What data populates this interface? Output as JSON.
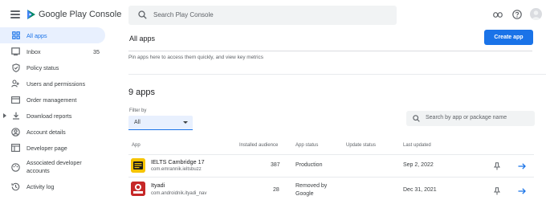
{
  "brand": {
    "name": "Google Play Console"
  },
  "search": {
    "placeholder": "Search Play Console"
  },
  "sidebar": {
    "items": [
      {
        "label": "All apps",
        "icon": "grid-icon",
        "active": true,
        "count": ""
      },
      {
        "label": "Inbox",
        "icon": "inbox-icon",
        "active": false,
        "count": "35"
      },
      {
        "label": "Policy status",
        "icon": "shield-icon",
        "active": false,
        "count": ""
      },
      {
        "label": "Users and permissions",
        "icon": "person-icon",
        "active": false,
        "count": ""
      },
      {
        "label": "Order management",
        "icon": "card-icon",
        "active": false,
        "count": ""
      },
      {
        "label": "Download reports",
        "icon": "download-icon",
        "active": false,
        "count": ""
      },
      {
        "label": "Account details",
        "icon": "account-icon",
        "active": false,
        "count": ""
      },
      {
        "label": "Developer page",
        "icon": "page-icon",
        "active": false,
        "count": ""
      },
      {
        "label": "Associated developer accounts",
        "icon": "palette-icon",
        "active": false,
        "count": ""
      },
      {
        "label": "Activity log",
        "icon": "history-icon",
        "active": false,
        "count": ""
      }
    ]
  },
  "main": {
    "title": "All apps",
    "create_button": "Create app",
    "pin_hint": "Pin apps here to access them quickly, and view key metrics",
    "apps_count": "9 apps",
    "filter": {
      "label": "Filter by",
      "value": "All"
    },
    "search_apps_placeholder": "Search by app or package name"
  },
  "table": {
    "headers": {
      "app": "App",
      "installed": "Installed audience",
      "status": "App status",
      "update": "Update status",
      "last_updated": "Last updated"
    },
    "rows": [
      {
        "name": "IELTS Cambridge 17",
        "package": "com.emrannik.ieltsbuzz",
        "installed": "387",
        "status": "Production",
        "status2": "",
        "update": "",
        "last_updated": "Sep 2, 2022"
      },
      {
        "name": "Ityadi",
        "package": "com.androidnik.ityadi_nav",
        "installed": "28",
        "status": "Removed by",
        "status2": "Google",
        "update": "",
        "last_updated": "Dec 31, 2021"
      }
    ]
  },
  "colors": {
    "accent": "#1a73e8",
    "active_bg": "#e8f0fe"
  }
}
